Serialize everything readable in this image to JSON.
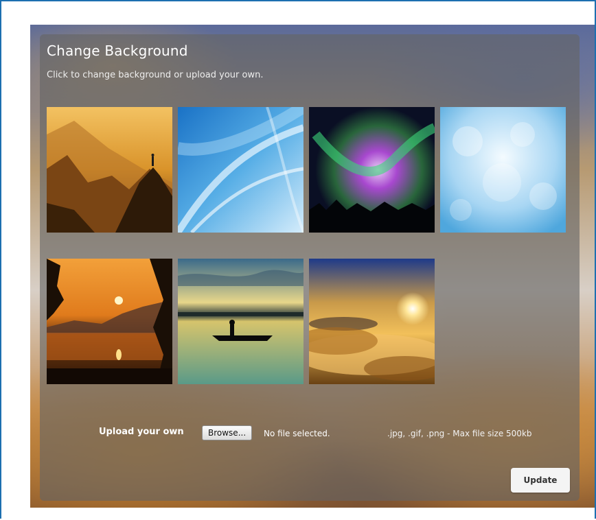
{
  "dialog": {
    "title": "Change Background",
    "subtitle": "Click to change background or upload your own."
  },
  "thumbnails": [
    {
      "name": "mountain-sunset-thumbnail",
      "theme": "golden mountain ridge with hiker silhouette"
    },
    {
      "name": "blue-abstract-thumbnail",
      "theme": "blue abstract curves"
    },
    {
      "name": "aurora-thumbnail",
      "theme": "aurora borealis over trees"
    },
    {
      "name": "light-blue-bokeh-thumbnail",
      "theme": "light blue bokeh"
    },
    {
      "name": "lake-sunset-thumbnail",
      "theme": "orange sunset over lake"
    },
    {
      "name": "canoe-lake-thumbnail",
      "theme": "canoe silhouette on calm lake"
    },
    {
      "name": "sun-above-clouds-thumbnail",
      "theme": "sun above clouds"
    }
  ],
  "upload": {
    "label": "Upload your own",
    "browse_label": "Browse...",
    "file_status": "No file selected.",
    "hint": ".jpg, .gif, .png - Max file size 500kb"
  },
  "actions": {
    "update_label": "Update"
  },
  "colors": {
    "frame_border": "#1c6fb0",
    "panel_overlay": "rgba(100,100,100,0.62)",
    "button_bg": "#f4f4f4"
  }
}
